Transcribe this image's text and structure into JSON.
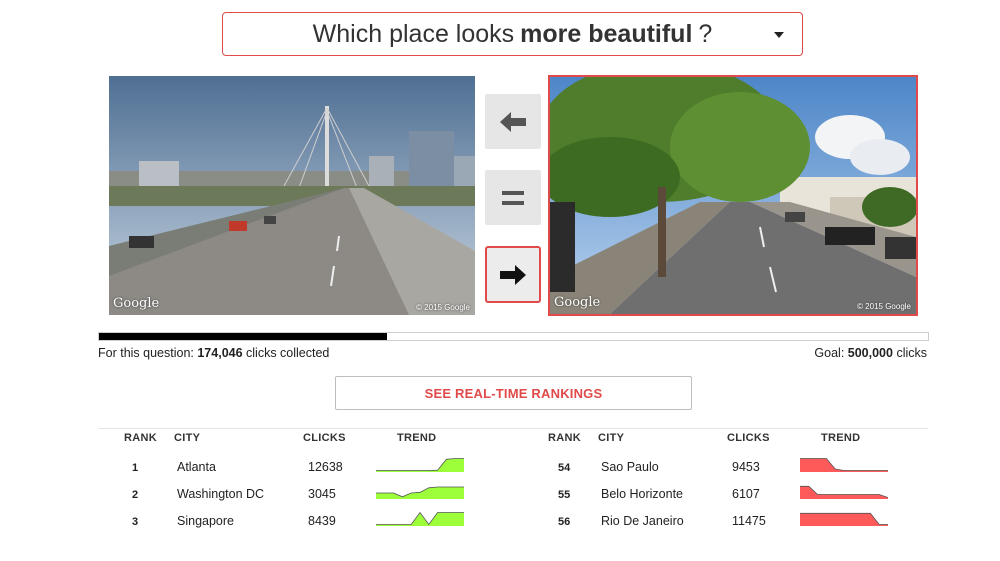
{
  "question": {
    "prefix": "Which place looks",
    "bold": "more beautiful",
    "suffix": "?"
  },
  "images": {
    "left": {
      "watermark": "Google",
      "copyright": "© 2015 Google",
      "selected": false
    },
    "right": {
      "watermark": "Google",
      "copyright": "© 2015 Google",
      "selected": true
    }
  },
  "vote_buttons": {
    "left": "arrow-left-icon",
    "equal": "equals-icon",
    "right": "arrow-right-icon"
  },
  "progress": {
    "fraction": 0.348,
    "left_label": "For this question: ",
    "left_count": "174,046",
    "left_suffix": " clicks collected",
    "goal_label": "Goal: ",
    "goal_count": "500,000",
    "goal_suffix": " clicks"
  },
  "rankings_button": "SEE REAL-TIME RANKINGS",
  "table_headers": {
    "rank": "RANK",
    "city": "CITY",
    "clicks": "CLICKS",
    "trend": "TREND"
  },
  "top_cities": [
    {
      "rank": "1",
      "city": "Atlanta",
      "clicks": "12638",
      "trend": [
        0.1,
        0.1,
        0.1,
        0.1,
        0.1,
        0.1,
        0.1,
        0.12,
        0.85,
        0.9,
        0.9
      ]
    },
    {
      "rank": "2",
      "city": "Washington DC",
      "clicks": "3045",
      "trend": [
        0.4,
        0.4,
        0.4,
        0.15,
        0.4,
        0.45,
        0.75,
        0.8,
        0.8,
        0.8,
        0.8
      ]
    },
    {
      "rank": "3",
      "city": "Singapore",
      "clicks": "8439",
      "trend": [
        0.1,
        0.1,
        0.1,
        0.1,
        0.1,
        0.9,
        0.1,
        0.9,
        0.9,
        0.9,
        0.9
      ]
    }
  ],
  "bottom_cities": [
    {
      "rank": "54",
      "city": "Sao Paulo",
      "clicks": "9453",
      "trend": [
        0.9,
        0.9,
        0.9,
        0.9,
        0.2,
        0.1,
        0.1,
        0.1,
        0.1,
        0.1,
        0.1
      ]
    },
    {
      "rank": "55",
      "city": "Belo Horizonte",
      "clicks": "6107",
      "trend": [
        0.85,
        0.85,
        0.3,
        0.3,
        0.3,
        0.3,
        0.3,
        0.3,
        0.3,
        0.3,
        0.1
      ]
    },
    {
      "rank": "56",
      "city": "Rio De Janeiro",
      "clicks": "11475",
      "trend": [
        0.85,
        0.85,
        0.85,
        0.85,
        0.85,
        0.85,
        0.85,
        0.85,
        0.85,
        0.1,
        0.1
      ]
    }
  ],
  "colors": {
    "accent": "#e04a4a",
    "trend_up": "#9cff3a",
    "trend_down": "#ff5a5a",
    "progress": "#000000"
  }
}
